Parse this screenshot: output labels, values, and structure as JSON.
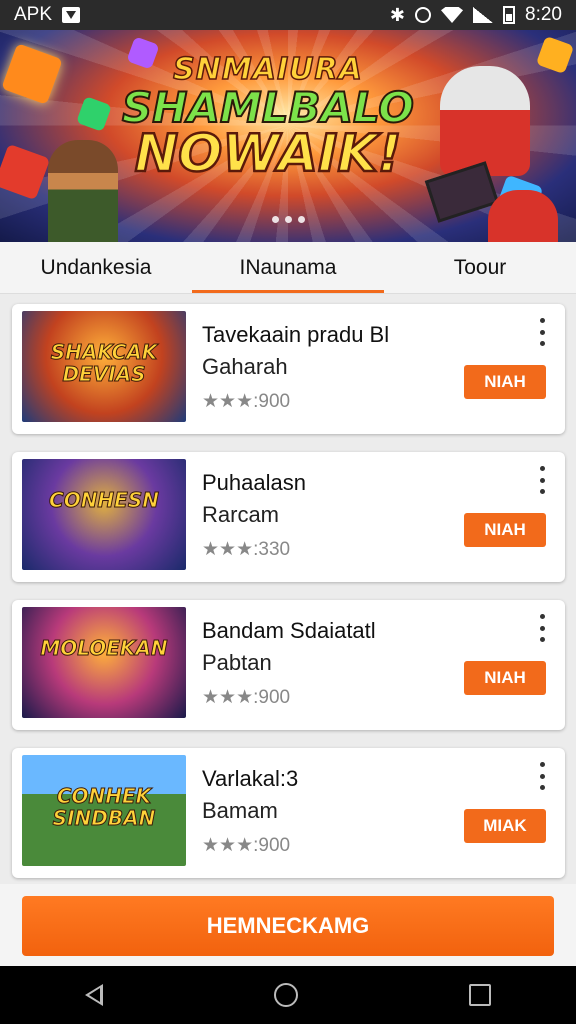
{
  "status_bar": {
    "carrier": "APK",
    "time": "8:20",
    "icons": [
      "notification-icon",
      "bluetooth-icon",
      "alarm-icon",
      "wifi-icon",
      "signal-icon",
      "battery-icon"
    ]
  },
  "banner": {
    "logo_line1": "SNMAIURA",
    "logo_line2": "SHAMLBALO",
    "logo_line3": "NOWAIK!",
    "page_count": 3
  },
  "tabs": [
    {
      "label": "Undankesia",
      "active": false
    },
    {
      "label": "INaunama",
      "active": true
    },
    {
      "label": "Toour",
      "active": false
    }
  ],
  "items": [
    {
      "title": "Tavekaain pradu Bl",
      "subtitle": "Gaharah",
      "rating": "★★★:900",
      "thumb_text": "SHAKCAK DEVIAS",
      "action": "NIAH"
    },
    {
      "title": "Puhaalasn",
      "subtitle": "Rarcam",
      "rating": "★★★:330",
      "thumb_text": "CONHESN",
      "action": "NIAH"
    },
    {
      "title": "Bandam Sdaiatatl",
      "subtitle": "Pabtan",
      "rating": "★★★:900",
      "thumb_text": "MOLOEKAN",
      "action": "NIAH"
    },
    {
      "title": "Varlakal:3",
      "subtitle": "Bamam",
      "rating": "★★★:900",
      "thumb_text": "CONHEK SINDBAN",
      "action": "MIAK"
    }
  ],
  "cta": {
    "label": "HEMNECKAMG"
  },
  "colors": {
    "accent": "#f26a1b",
    "status_bar": "#2b2b2b",
    "background": "#ececec"
  }
}
